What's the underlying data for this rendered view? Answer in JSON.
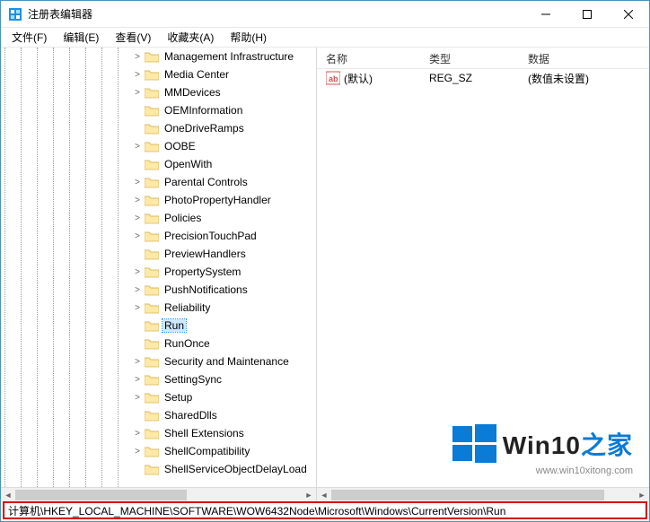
{
  "window": {
    "title": "注册表编辑器"
  },
  "menu": {
    "file": "文件(F)",
    "edit": "编辑(E)",
    "view": "查看(V)",
    "favorites": "收藏夹(A)",
    "help": "帮助(H)"
  },
  "tree": {
    "selected": "Run",
    "items": [
      {
        "label": "Management Infrastructure",
        "expandable": true
      },
      {
        "label": "Media Center",
        "expandable": true
      },
      {
        "label": "MMDevices",
        "expandable": true
      },
      {
        "label": "OEMInformation",
        "expandable": false
      },
      {
        "label": "OneDriveRamps",
        "expandable": false
      },
      {
        "label": "OOBE",
        "expandable": true
      },
      {
        "label": "OpenWith",
        "expandable": false
      },
      {
        "label": "Parental Controls",
        "expandable": true
      },
      {
        "label": "PhotoPropertyHandler",
        "expandable": true
      },
      {
        "label": "Policies",
        "expandable": true
      },
      {
        "label": "PrecisionTouchPad",
        "expandable": true
      },
      {
        "label": "PreviewHandlers",
        "expandable": false
      },
      {
        "label": "PropertySystem",
        "expandable": true
      },
      {
        "label": "PushNotifications",
        "expandable": true
      },
      {
        "label": "Reliability",
        "expandable": true
      },
      {
        "label": "Run",
        "expandable": false,
        "selected": true
      },
      {
        "label": "RunOnce",
        "expandable": false
      },
      {
        "label": "Security and Maintenance",
        "expandable": true
      },
      {
        "label": "SettingSync",
        "expandable": true
      },
      {
        "label": "Setup",
        "expandable": true
      },
      {
        "label": "SharedDlls",
        "expandable": false
      },
      {
        "label": "Shell Extensions",
        "expandable": true
      },
      {
        "label": "ShellCompatibility",
        "expandable": true
      },
      {
        "label": "ShellServiceObjectDelayLoad",
        "expandable": false
      }
    ]
  },
  "list": {
    "columns": {
      "name": "名称",
      "type": "类型",
      "data": "数据"
    },
    "rows": [
      {
        "name": "(默认)",
        "type": "REG_SZ",
        "data": "(数值未设置)",
        "icon": "ab"
      }
    ]
  },
  "statusbar": {
    "path": "计算机\\HKEY_LOCAL_MACHINE\\SOFTWARE\\WOW6432Node\\Microsoft\\Windows\\CurrentVersion\\Run"
  },
  "watermark": {
    "brand": "Win10",
    "suffix": "之家",
    "url": "www.win10xitong.com"
  }
}
